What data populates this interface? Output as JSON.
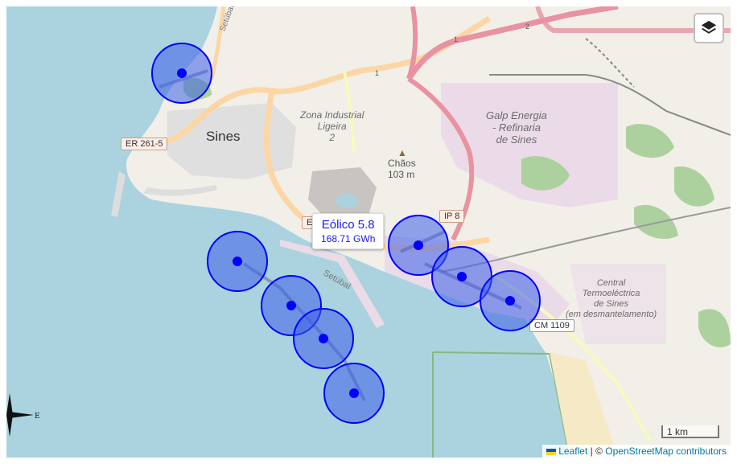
{
  "map": {
    "town": "Sines",
    "places": {
      "zona_industrial": "Zona Industrial\nLigeira\n2",
      "galp": "Galp Energia\n- Refinaria\nde Sines",
      "chaos_name": "Chãos",
      "chaos_elev": "103 m",
      "central": "Central\nTermoeléctrica\nde Sines\n(em desmantelamento)",
      "setubal_top": "Setúbal",
      "setubal_coast": "Setúbal"
    },
    "roads": {
      "er2615": "ER 261-5",
      "ip8": "IP 8",
      "cm1109": "CM 1109",
      "er_partial": "ER",
      "route1_a": "1",
      "route1_b": "1",
      "route2": "2"
    },
    "colors": {
      "sea": "#aad3df",
      "land": "#f2efe9",
      "industrial": "#ebdbe8",
      "motorway": "#e892a2",
      "primary": "#fcd6a4",
      "forest": "#add19e",
      "marker_fill": "#3d5ee8",
      "marker_stroke": "#0000ff"
    }
  },
  "markers": [
    {
      "name": "wind-site-1"
    },
    {
      "name": "wind-site-2"
    },
    {
      "name": "wind-site-3"
    },
    {
      "name": "wind-site-4"
    },
    {
      "name": "wind-site-5"
    },
    {
      "name": "wind-site-6"
    },
    {
      "name": "wind-site-7"
    },
    {
      "name": "wind-site-8"
    },
    {
      "name": "wind-site-9"
    }
  ],
  "tooltip": {
    "title": "Eólico 5.8",
    "value": "168.71 GWh"
  },
  "controls": {
    "layers_icon": "layers-icon",
    "compass_label": "E"
  },
  "scale": {
    "label": "1 km"
  },
  "attribution": {
    "leaflet": "Leaflet",
    "separator": " | © ",
    "osm": "OpenStreetMap contributors"
  }
}
